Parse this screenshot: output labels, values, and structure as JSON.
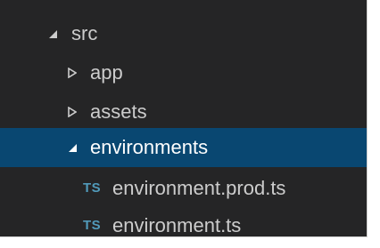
{
  "explorer": {
    "items": [
      {
        "label": "src",
        "expanded": true,
        "kind": "folder",
        "icon": "chevron-expanded-icon"
      },
      {
        "label": "app",
        "expanded": false,
        "kind": "folder",
        "icon": "chevron-collapsed-icon"
      },
      {
        "label": "assets",
        "expanded": false,
        "kind": "folder",
        "icon": "chevron-collapsed-icon"
      },
      {
        "label": "environments",
        "expanded": true,
        "kind": "folder",
        "selected": true,
        "icon": "chevron-expanded-icon"
      },
      {
        "label": "environment.prod.ts",
        "kind": "file",
        "badge": "TS",
        "icon": "typescript-file-icon"
      },
      {
        "label": "environment.ts",
        "kind": "file",
        "badge": "TS",
        "icon": "typescript-file-icon"
      }
    ]
  },
  "colors": {
    "panel_bg": "#252526",
    "selected_bg": "#094771",
    "text": "#cccccc",
    "selected_text": "#ffffff",
    "ts_badge": "#519aba"
  }
}
